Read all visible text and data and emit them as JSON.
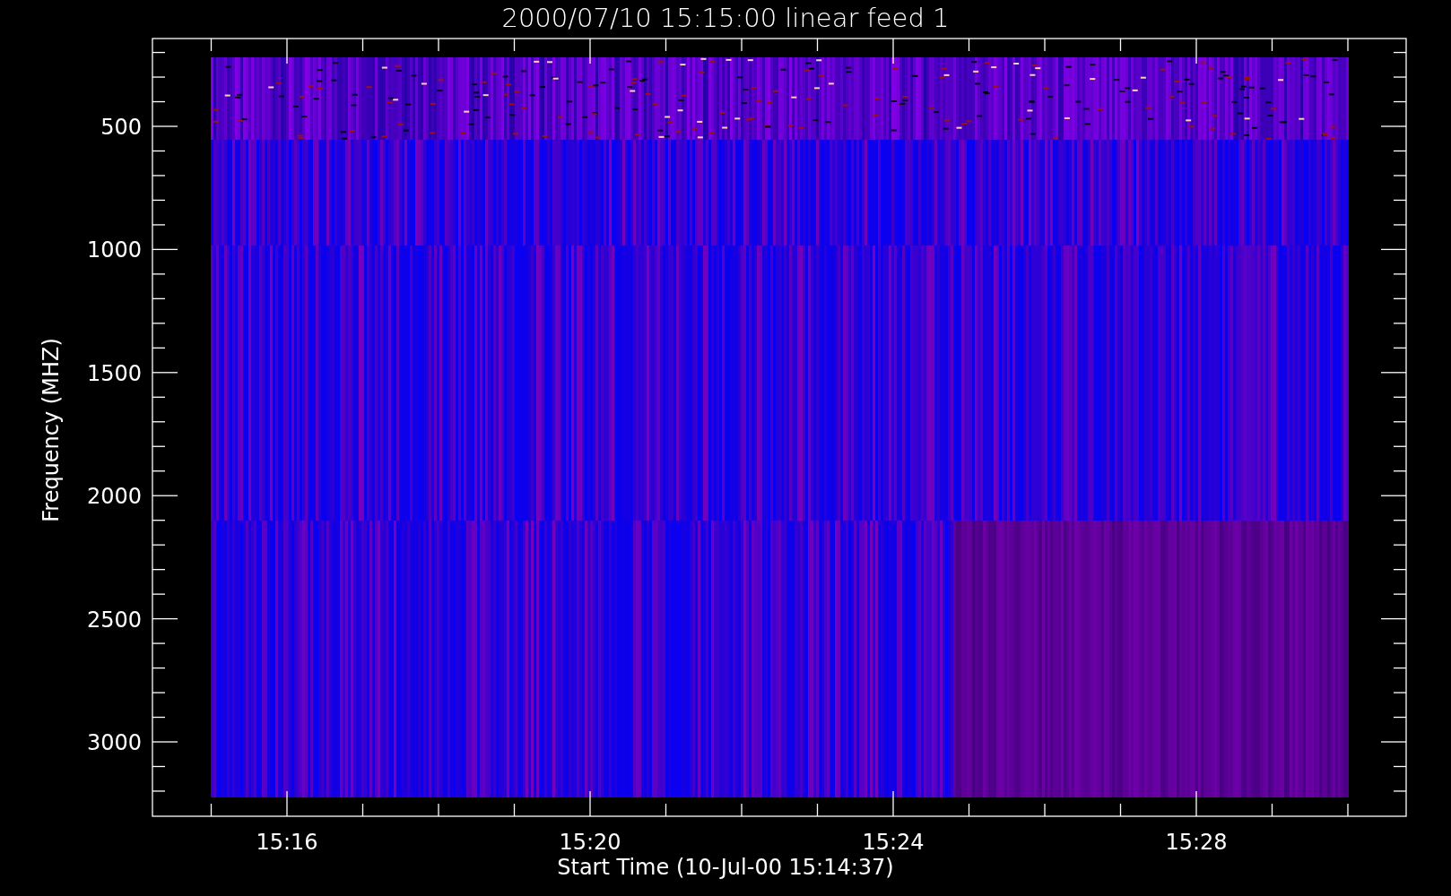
{
  "plot": {
    "title": "2000/07/10 15:15:00 linear feed 1",
    "x_axis": {
      "label": "Start Time (10-Jul-00 15:14:37)",
      "tick_labels": [
        "15:16",
        "15:20",
        "15:24",
        "15:28"
      ]
    },
    "y_axis": {
      "label": "Frequency (MHZ)",
      "tick_labels": [
        "500",
        "1000",
        "1500",
        "2000",
        "2500",
        "3000"
      ]
    }
  }
}
